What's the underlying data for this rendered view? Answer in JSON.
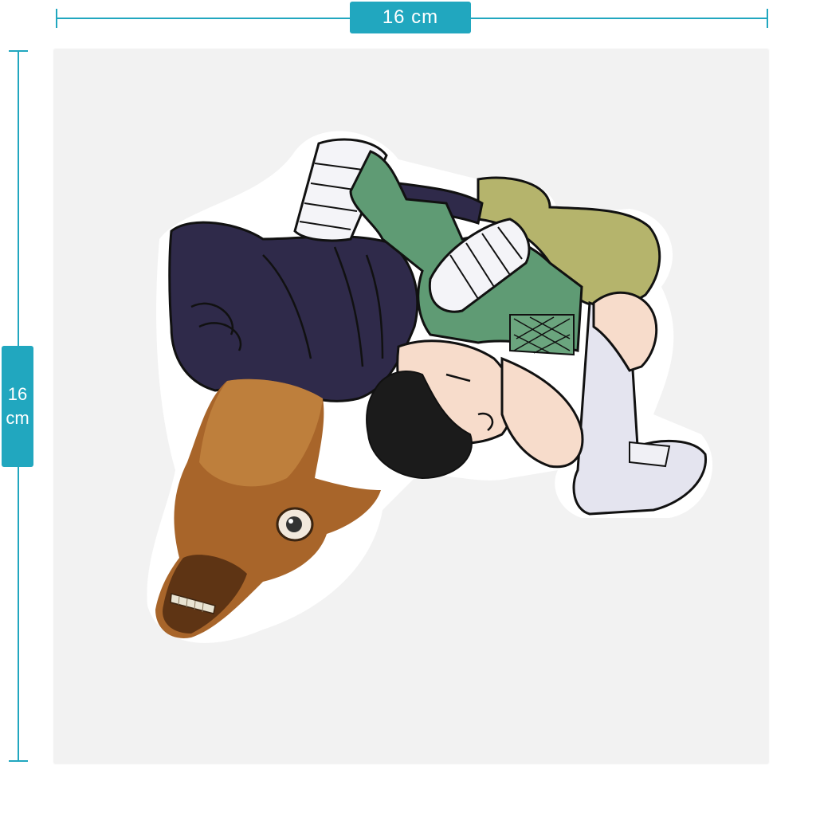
{
  "dimension": {
    "width_label": "16 cm",
    "height_value": "16",
    "height_unit": "cm"
  },
  "colors": {
    "accent": "#21a7bf",
    "sheet": "#f2f2f2",
    "suit_dark": "#2f2a4a",
    "vest_green": "#5f9b74",
    "leg_olive": "#b5b46c",
    "wrap_white": "#e4e4ef",
    "skin": "#f7dccb",
    "hair": "#1b1b1b",
    "horse": "#a8652a"
  },
  "icons": [
    "sticker-illustration"
  ]
}
